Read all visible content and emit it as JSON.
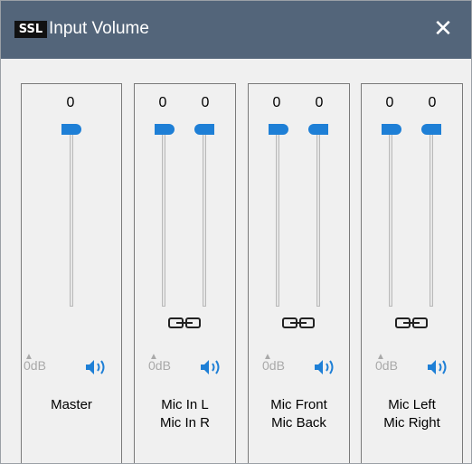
{
  "titlebar": {
    "logo": "SSL",
    "title": "Input Volume",
    "close_glyph": "✕"
  },
  "channels": [
    {
      "values": [
        "0"
      ],
      "db_label": "0dB",
      "label": "Master",
      "linked": false
    },
    {
      "values": [
        "0",
        "0"
      ],
      "db_label": "0dB",
      "label": "Mic In L\nMic In R",
      "linked": true
    },
    {
      "values": [
        "0",
        "0"
      ],
      "db_label": "0dB",
      "label": "Mic Front\nMic Back",
      "linked": true
    },
    {
      "values": [
        "0",
        "0"
      ],
      "db_label": "0dB",
      "label": "Mic Left\nMic Right",
      "linked": true
    }
  ],
  "colors": {
    "titlebar": "#53657a",
    "accent": "#1e7fd6",
    "disabled": "#a9a9a9"
  }
}
